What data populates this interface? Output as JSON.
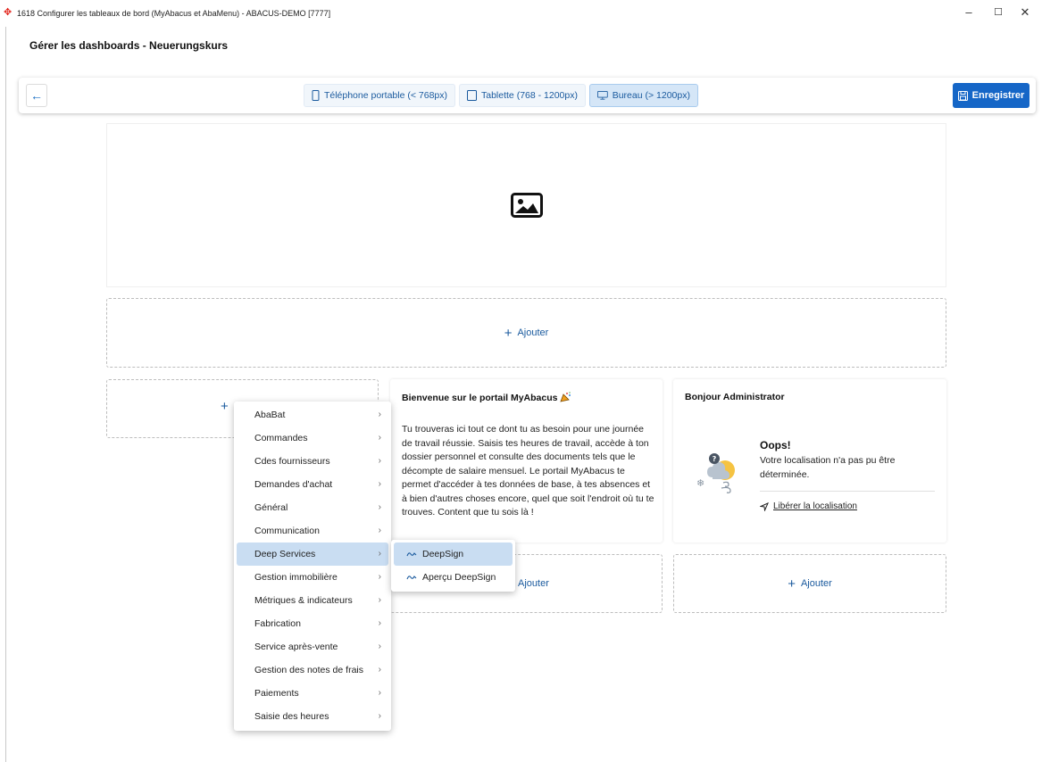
{
  "window": {
    "title": "1618 Configurer les tableaux de bord (MyAbacus et AbaMenu) - ABACUS-DEMO [7777]",
    "logo_icon": "abacus-logo-icon",
    "minimize": "–",
    "maximize": "☐",
    "close": "✕"
  },
  "page": {
    "title": "Gérer les dashboards - Neuerungskurs"
  },
  "toolbar": {
    "back_icon": "arrow-left-icon",
    "devices": [
      {
        "label": "Téléphone portable (< 768px)",
        "icon": "smartphone-icon",
        "selected": false
      },
      {
        "label": "Tablette (768 - 1200px)",
        "icon": "tablet-icon",
        "selected": false
      },
      {
        "label": "Bureau (> 1200px)",
        "icon": "monitor-icon",
        "selected": true
      }
    ],
    "save_label": "Enregistrer",
    "save_icon": "save-icon"
  },
  "dashboard": {
    "image_placeholder_icon": "image-icon",
    "add_label": "Ajouter",
    "welcome": {
      "title": "Bienvenue sur le portail MyAbacus",
      "emoji": "party-popper-icon",
      "text": "Tu trouveras ici tout ce dont tu as besoin pour une journée de travail réussie. Saisis tes heures de travail, accède à ton dossier personnel et consulte des documents tels que le décompte de salaire mensuel. Le portail MyAbacus te permet d'accéder à tes données de base, à tes absences et à bien d'autres choses encore, quel que soit l'endroit où tu te trouves. Content que tu sois là !"
    },
    "hello": {
      "title": "Bonjour Administrator",
      "oops_title": "Oops!",
      "oops_text": "Votre localisation n'a pas pu être déterminée.",
      "link_label": "Libérer la localisation",
      "link_icon": "navigation-arrow-icon"
    }
  },
  "menu": {
    "items": [
      {
        "label": "AbaBat",
        "active": false
      },
      {
        "label": "Commandes",
        "active": false
      },
      {
        "label": "Cdes fournisseurs",
        "active": false
      },
      {
        "label": "Demandes d'achat",
        "active": false
      },
      {
        "label": "Général",
        "active": false
      },
      {
        "label": "Communication",
        "active": false
      },
      {
        "label": "Deep Services",
        "active": true
      },
      {
        "label": "Gestion immobilière",
        "active": false
      },
      {
        "label": "Métriques & indicateurs",
        "active": false
      },
      {
        "label": "Fabrication",
        "active": false
      },
      {
        "label": "Service après-vente",
        "active": false
      },
      {
        "label": "Gestion des notes de frais",
        "active": false
      },
      {
        "label": "Paiements",
        "active": false
      },
      {
        "label": "Saisie des heures",
        "active": false
      }
    ],
    "submenu": [
      {
        "label": "DeepSign",
        "icon": "signature-icon",
        "active": true
      },
      {
        "label": "Aperçu DeepSign",
        "icon": "signature-icon",
        "active": false
      }
    ]
  },
  "colors": {
    "accent": "#1566c7",
    "selected_bg": "#c9ddf2",
    "link_blue": "#1a5a9e"
  }
}
